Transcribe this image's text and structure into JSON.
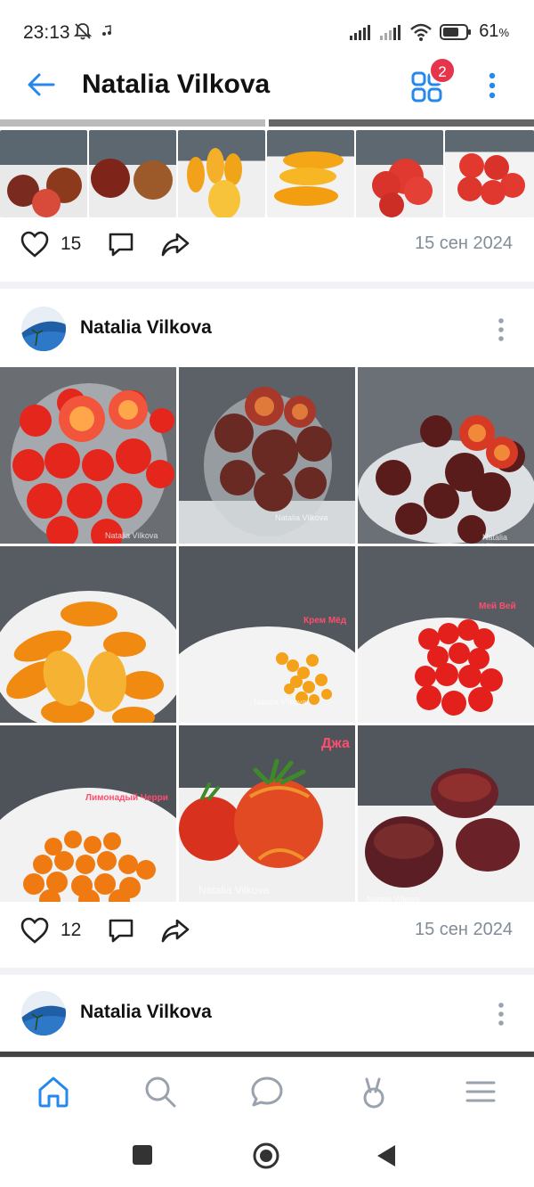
{
  "status_bar": {
    "time": "23:13",
    "battery_percent": "61",
    "battery_unit": "%"
  },
  "header": {
    "title": "Natalia Vilkova",
    "apps_badge": "2"
  },
  "posts": [
    {
      "likes": "15",
      "date": "15 сен 2024"
    },
    {
      "author": "Natalia Vilkova",
      "likes": "12",
      "date": "15 сен 2024",
      "photo_labels": [
        "Крем Мёд",
        "Мей Вей",
        "Лимонадый Черри",
        "Джа"
      ],
      "watermark": "Natalia Vilkova"
    },
    {
      "author": "Natalia Vilkova"
    }
  ],
  "icons": {
    "back": "arrow-left-icon",
    "apps": "apps-grid-icon",
    "more": "more-vertical-icon",
    "like": "heart-icon",
    "comment": "comment-icon",
    "share": "share-icon",
    "nav_home": "home-icon",
    "nav_search": "search-icon",
    "nav_messages": "chat-icon",
    "nav_clips": "clips-icon",
    "nav_menu": "menu-icon"
  },
  "colors": {
    "accent": "#2688eb",
    "badge": "#e5344b",
    "secondary_text": "#818c99"
  }
}
